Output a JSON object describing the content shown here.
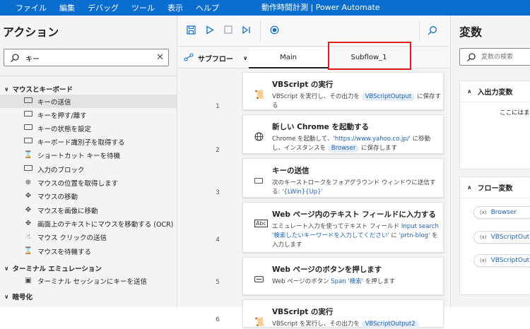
{
  "menu": [
    "ファイル",
    "編集",
    "デバッグ",
    "ツール",
    "表示",
    "ヘルプ"
  ],
  "window_title": "動作時間計測 | Power Automate",
  "actions": {
    "title": "アクション",
    "search_value": "キー",
    "groups": [
      {
        "label": "マウスとキーボード"
      },
      {
        "label": "ターミナル エミュレーション"
      },
      {
        "label": "暗号化"
      }
    ],
    "items": [
      {
        "label": "キーの送信",
        "icon": "keyboard-icon"
      },
      {
        "label": "キーを押す/離す",
        "icon": "keyboard-icon"
      },
      {
        "label": "キーの状態を設定",
        "icon": "keyboard-icon"
      },
      {
        "label": "キーボード識別子を取得する",
        "icon": "keyboard-icon"
      },
      {
        "label": "ショートカット キーを待機",
        "icon": "hourglass-icon"
      },
      {
        "label": "入力のブロック",
        "icon": "keyboard-icon"
      },
      {
        "label": "マウスの位置を取得します",
        "icon": "mouse-target-icon"
      },
      {
        "label": "マウスの移動",
        "icon": "mouse-move-icon"
      },
      {
        "label": "マウスを画像に移動",
        "icon": "mouse-move-icon"
      },
      {
        "label": "画面上のテキストにマウスを移動する (OCR)",
        "icon": "mouse-move-icon"
      },
      {
        "label": "マウス クリックの送信",
        "icon": "mouse-click-icon"
      },
      {
        "label": "マウスを待機する",
        "icon": "hourglass-icon"
      },
      {
        "label": "ターミナル セッションにキーを送信",
        "icon": "terminal-icon"
      }
    ]
  },
  "editor": {
    "subflow_label": "サブフロー",
    "tabs": [
      "Main",
      "Subflow_1"
    ],
    "line_numbers": [
      "1",
      "2",
      "3",
      "4",
      "5",
      "6"
    ],
    "cards": [
      {
        "title": "VBScript の実行",
        "icon": "script-icon",
        "desc": [
          {
            "t": "VBScript を実行し、その出力を "
          },
          {
            "p": "VBScriptOutput"
          },
          {
            "t": " に保存する"
          }
        ]
      },
      {
        "title": "新しい Chrome を起動する",
        "icon": "globe-icon",
        "desc": [
          {
            "t": "Chrome を起動して、"
          },
          {
            "l": "'https://www.yahoo.co.jp/'"
          },
          {
            "t": " に移動し、インスタンスを "
          },
          {
            "p": "Browser"
          },
          {
            "t": " に保存します"
          }
        ]
      },
      {
        "title": "キーの送信",
        "icon": "keyboard-icon",
        "desc": [
          {
            "t": "次のキーストロークをフォアグラウンド ウィンドウに送信する: "
          },
          {
            "l": "'{LWin}{Up}'"
          }
        ]
      },
      {
        "title": "Web ページ内のテキスト フィールドに入力する",
        "icon": "textfield-icon",
        "desc": [
          {
            "t": "エミュレート入力を使ってテキスト フィールド "
          },
          {
            "l": "Input search"
          },
          {
            "t": " "
          },
          {
            "l": "'検索したいキーワードを入力してください'"
          },
          {
            "t": " に "
          },
          {
            "l": "'prtn-blog'"
          },
          {
            "t": " を入力します"
          }
        ]
      },
      {
        "title": "Web ページのボタンを押します",
        "icon": "button-icon",
        "desc": [
          {
            "t": "Web ページのボタン "
          },
          {
            "l": "Span '検索'"
          },
          {
            "t": " を押します"
          }
        ]
      },
      {
        "title": "VBScript の実行",
        "icon": "script-icon",
        "desc": [
          {
            "t": "VBScript を実行し、その出力を "
          },
          {
            "p": "VBScriptOutput2"
          }
        ]
      }
    ]
  },
  "variables": {
    "title": "変数",
    "search_placeholder": "変数の検索",
    "io_section": "入出力変数",
    "io_note": "ここにはま",
    "flow_section": "フロー変数",
    "flow_vars": [
      "Browser",
      "VBScriptOut",
      "VBScriptOut"
    ]
  }
}
